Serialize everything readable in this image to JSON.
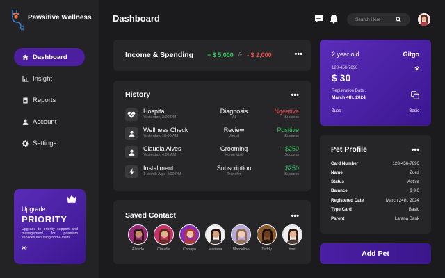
{
  "brand": {
    "name": "Pawsitive Wellness",
    "accent": "#4b1fa0"
  },
  "nav": [
    {
      "label": "Dashboard",
      "icon": "home-icon",
      "active": true
    },
    {
      "label": "Insight",
      "icon": "bar-chart-icon",
      "active": false
    },
    {
      "label": "Reports",
      "icon": "document-icon",
      "active": false
    },
    {
      "label": "Account",
      "icon": "user-icon",
      "active": false
    },
    {
      "label": "Settings",
      "icon": "gear-icon",
      "active": false
    }
  ],
  "upgrade": {
    "title": "Upgrade",
    "plan": "PRIORITY",
    "description": "Upgrade to priority support and management for premium services including home visits",
    "arrows": "›››"
  },
  "header": {
    "title": "Dashboard",
    "search_placeholder": "Search Here"
  },
  "income": {
    "title": "Income & Spending",
    "income": "+ $ 5,000",
    "separator": "&",
    "spending": "- $ 2,000"
  },
  "history": {
    "title": "History",
    "rows": [
      {
        "name": "Hospital",
        "time": "Yesterday, 2:00 PM",
        "type": "Diagnosis",
        "method": "AI",
        "amount": "Ngeative",
        "status": "Success",
        "amount_color": "#e9484c",
        "icon": "heartbeat-icon"
      },
      {
        "name": "Wellness Check",
        "time": "Yesterday, 10:00 AM",
        "type": "Review",
        "method": "Virtual",
        "amount": "Positive",
        "status": "Success",
        "amount_color": "#37c862",
        "icon": "user-icon"
      },
      {
        "name": "Claudia Alves",
        "time": "Yesterday, 4:00 AM",
        "type": "Grooming",
        "method": "Home Visit",
        "amount": "- $250",
        "status": "Success",
        "amount_color": "#37c862",
        "icon": "user-icon"
      },
      {
        "name": "Installment",
        "time": "1 Month Ago, 4:00 PM",
        "type": "Subscription",
        "method": "Transfer",
        "amount": "$250",
        "status": "Success",
        "amount_color": "#37c862",
        "icon": "lightning-icon"
      }
    ]
  },
  "saved": {
    "title": "Saved Contact",
    "contacts": [
      {
        "name": "Alfredo",
        "bg": "#9b2a7a",
        "skin": "#c98b6a",
        "hair": "#2b1a12"
      },
      {
        "name": "Claudia",
        "bg": "#c8306a",
        "skin": "#e6b08e",
        "hair": "#5a2a1a"
      },
      {
        "name": "Cahaya",
        "bg": "#8a2bb0",
        "skin": "#f0c2a6",
        "hair": "#b23a2c"
      },
      {
        "name": "Mariana",
        "bg": "#f2f2f2",
        "skin": "#d7a07e",
        "hair": "#1e1410"
      },
      {
        "name": "Marcelino",
        "bg": "#b9a8d9",
        "skin": "#f0cdb4",
        "hair": "#8a6a4a"
      },
      {
        "name": "Teddy",
        "bg": "#8b5a2b",
        "skin": "#6b3e24",
        "hair": "#1a0f08"
      },
      {
        "name": "Yael",
        "bg": "#eeeeee",
        "skin": "#e6b394",
        "hair": "#2a1a12"
      }
    ]
  },
  "pet_card": {
    "age": "2 year old",
    "name": "Gitgo",
    "phone": "123-456-7890",
    "balance": "$ 30",
    "reg_label": "Registration Date :",
    "reg_date": "March 4th, 2024",
    "owner": "Zues",
    "plan": "Basic"
  },
  "profile": {
    "title": "Pet Profile",
    "rows": [
      {
        "key": "Card Number",
        "value": "123-456-7890"
      },
      {
        "key": "Name",
        "value": "Zues"
      },
      {
        "key": "Status",
        "value": "Active"
      },
      {
        "key": "Balance",
        "value": "$ 3.0"
      },
      {
        "key": "Registered Date",
        "value": "March 24th, 2024"
      },
      {
        "key": "Type Card",
        "value": "Basic"
      },
      {
        "key": "Parent",
        "value": "Larana Bank"
      }
    ]
  },
  "add_pet_label": "Add Pet",
  "more_dots": "•••"
}
